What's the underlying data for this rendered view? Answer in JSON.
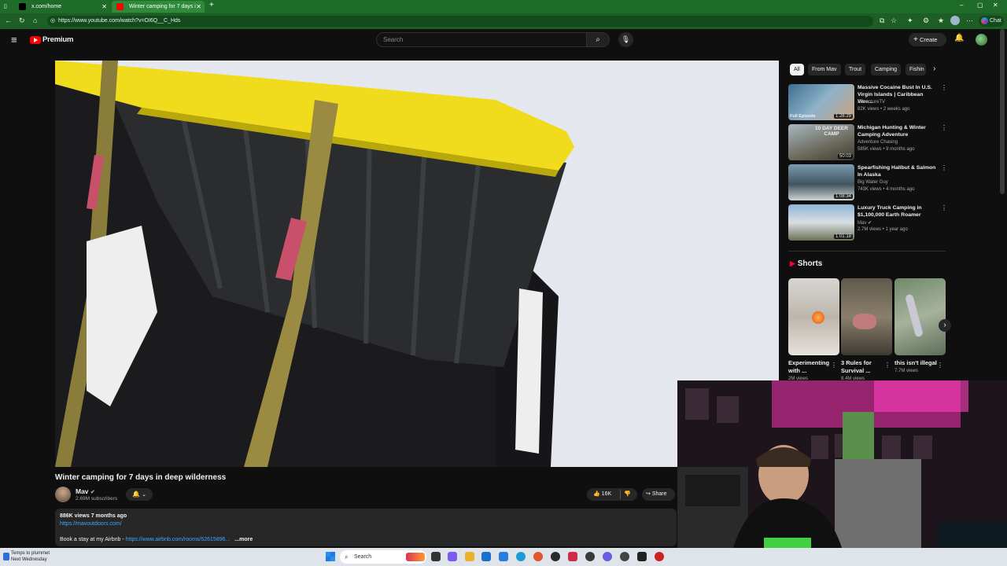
{
  "browser": {
    "tabs": [
      {
        "label": "x.com/home"
      },
      {
        "label": "Winter camping for 7 days i"
      }
    ],
    "url": "https://www.youtube.com/watch?v=OI6Q__C_Hds",
    "chat_label": "Chat"
  },
  "header": {
    "brand": "Premium",
    "search_placeholder": "Search",
    "create_label": "Create"
  },
  "video": {
    "title": "Winter camping for 7 days in deep wilderness",
    "channel": "Mav",
    "subscribers": "2.69M subscribers",
    "likes": "16K",
    "share_label": "Share",
    "views_date": "886K views  7 months ago",
    "link1": "https://mavoutdoors.com/",
    "desc_line2_prefix": "Book a stay at my Airbnb - ",
    "link2": "https://www.airbnb.com/rooms/52615896...",
    "more_label": "...more"
  },
  "sidebar": {
    "chips": [
      "All",
      "From Mav",
      "Trout",
      "Camping",
      "Fishin"
    ],
    "recommendations": [
      {
        "title": "Massive Cocaine Bust In U.S. Virgin Islands | Caribbean Vice...",
        "channel": "AdventureTV",
        "meta": "82K views • 2 weeks ago",
        "duration": "1:28:29",
        "badge": "Full Episode"
      },
      {
        "title": "Michigan Hunting & Winter Camping Adventure",
        "channel": "Adventure Chasing",
        "meta": "585K views • 9 months ago",
        "duration": "50:03",
        "badge": "10 DAY DEER CAMP"
      },
      {
        "title": "Spearfishing Halibut & Salmon In Alaska",
        "channel": "Big Water Guy",
        "meta": "743K views • 4 months ago",
        "duration": "1:08:34",
        "badge": ""
      },
      {
        "title": "Luxury Truck Camping in $1,100,000 Earth Roamer",
        "channel": "Mav",
        "meta": "2.7M views • 1 year ago",
        "duration": "1:01:18",
        "badge": ""
      }
    ],
    "shorts_heading": "Shorts",
    "shorts": [
      {
        "title": "Experimenting with ...",
        "views": "2M views"
      },
      {
        "title": "3 Rules for Survival ...",
        "views": "8.4M views"
      },
      {
        "title": "this isn't illegal",
        "views": "7.7M views"
      }
    ]
  },
  "taskbar": {
    "weather_line1": "Temps to plummet",
    "weather_line2": "Next Wednesday",
    "search_label": "Search"
  },
  "colors": {
    "browser_green": "#1f6b2a",
    "yt_red": "#ff0000",
    "link_blue": "#3ea6ff"
  }
}
